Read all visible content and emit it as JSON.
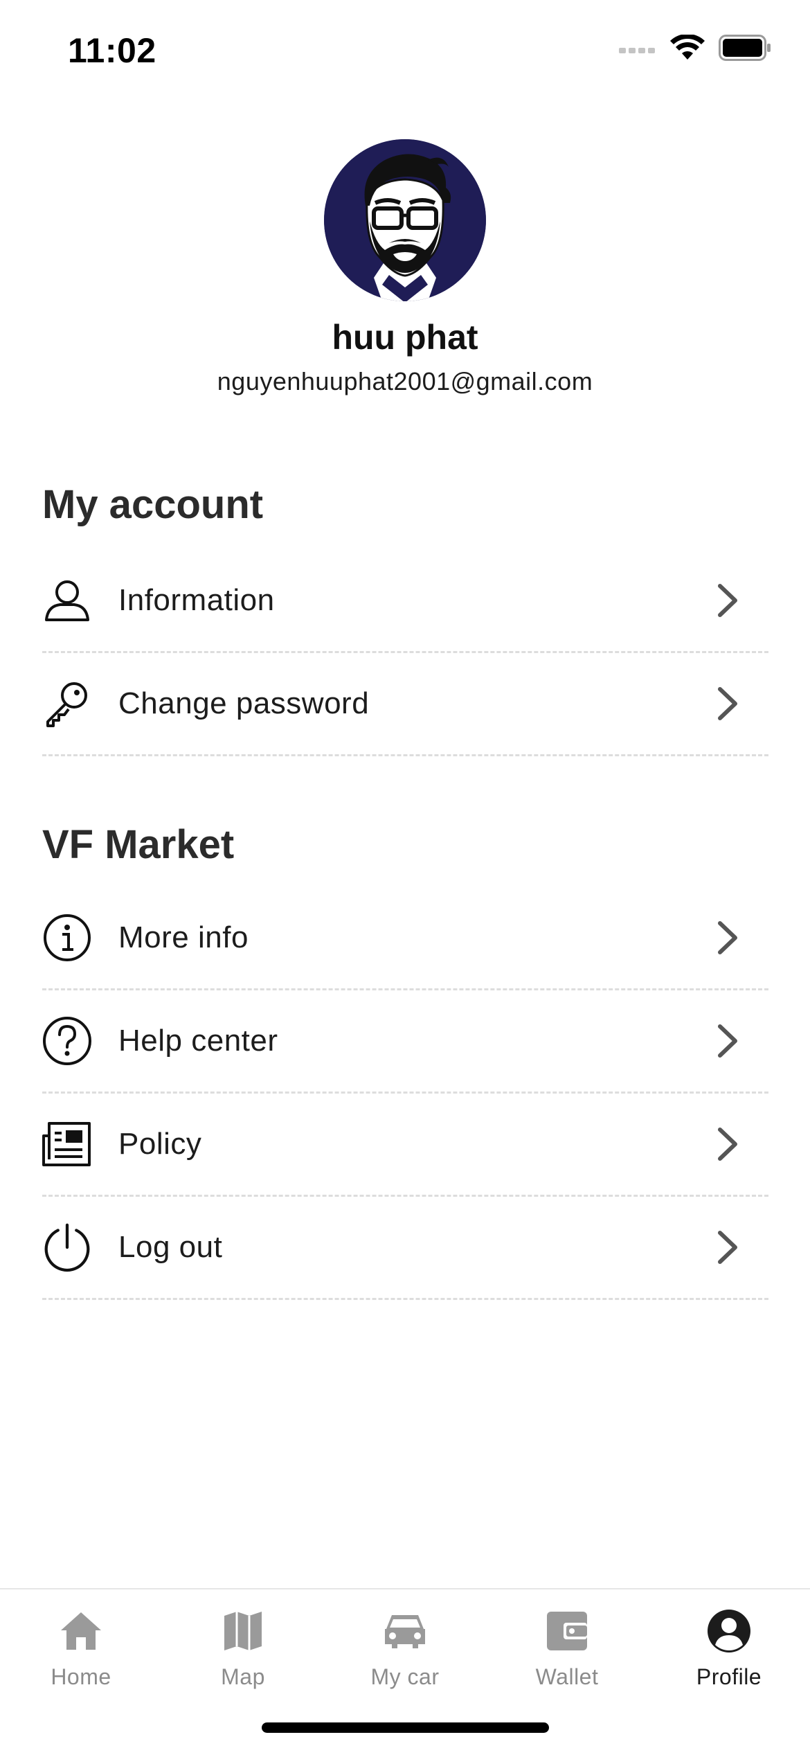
{
  "status_bar": {
    "time": "11:02"
  },
  "profile": {
    "name": "huu phat",
    "email": "nguyenhuuphat2001@gmail.com"
  },
  "sections": [
    {
      "title": "My account",
      "items": [
        {
          "label": "Information",
          "icon": "user-icon"
        },
        {
          "label": "Change password",
          "icon": "key-icon"
        }
      ]
    },
    {
      "title": "VF Market",
      "items": [
        {
          "label": "More info",
          "icon": "info-icon"
        },
        {
          "label": "Help center",
          "icon": "help-icon"
        },
        {
          "label": "Policy",
          "icon": "policy-icon"
        },
        {
          "label": "Log out",
          "icon": "power-icon"
        }
      ]
    }
  ],
  "bottom_nav": {
    "tabs": [
      {
        "label": "Home",
        "icon": "home-icon"
      },
      {
        "label": "Map",
        "icon": "map-icon"
      },
      {
        "label": "My car",
        "icon": "car-icon"
      },
      {
        "label": "Wallet",
        "icon": "wallet-icon"
      },
      {
        "label": "Profile",
        "icon": "profile-icon"
      }
    ],
    "active_tab": "Profile"
  },
  "colors": {
    "avatar_bg": "#1f1d56",
    "nav_inactive": "#8b8b8b",
    "nav_active": "#1c1c1c",
    "divider": "#dddddd"
  }
}
